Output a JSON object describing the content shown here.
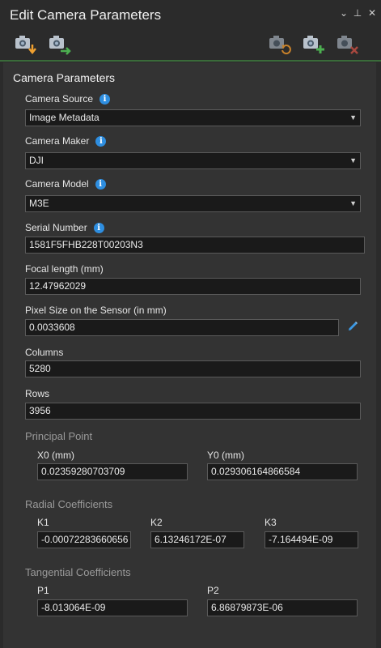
{
  "title_bar": {
    "title": "Edit Camera Parameters",
    "options_glyph": "⌄",
    "pin_glyph": "⊥",
    "close_glyph": "✕"
  },
  "toolbar": {
    "buttons": [
      {
        "name": "import-camera-icon"
      },
      {
        "name": "export-camera-icon"
      },
      {
        "name": "refresh-camera-icon"
      },
      {
        "name": "add-camera-icon"
      },
      {
        "name": "remove-camera-icon"
      }
    ],
    "colors": {
      "accent_orange": "#f0a030",
      "accent_green": "#4caf50",
      "accent_red": "#d9534f",
      "separator": "#3a6b3a"
    }
  },
  "section": {
    "title": "Camera Parameters"
  },
  "fields": {
    "camera_source": {
      "label": "Camera Source",
      "value": "Image Metadata"
    },
    "camera_maker": {
      "label": "Camera Maker",
      "value": "DJI"
    },
    "camera_model": {
      "label": "Camera Model",
      "value": "M3E"
    },
    "serial_number": {
      "label": "Serial Number",
      "value": "1581F5FHB228T00203N3"
    },
    "focal_length": {
      "label": "Focal length (mm)",
      "value": "12.47962029"
    },
    "pixel_size": {
      "label": "Pixel Size on the Sensor (in mm)",
      "value": "0.0033608"
    },
    "columns": {
      "label": "Columns",
      "value": "5280"
    },
    "rows": {
      "label": "Rows",
      "value": "3956"
    }
  },
  "principal_point": {
    "title": "Principal Point",
    "x0": {
      "label": "X0 (mm)",
      "value": "0.02359280703709"
    },
    "y0": {
      "label": "Y0 (mm)",
      "value": "0.029306164866584"
    }
  },
  "radial": {
    "title": "Radial Coefficients",
    "k1": {
      "label": "K1",
      "value": "-0.00072283660656"
    },
    "k2": {
      "label": "K2",
      "value": "6.13246172E-07"
    },
    "k3": {
      "label": "K3",
      "value": "-7.164494E-09"
    }
  },
  "tangential": {
    "title": "Tangential Coefficients",
    "p1": {
      "label": "P1",
      "value": "-8.013064E-09"
    },
    "p2": {
      "label": "P2",
      "value": "6.86879873E-06"
    }
  }
}
